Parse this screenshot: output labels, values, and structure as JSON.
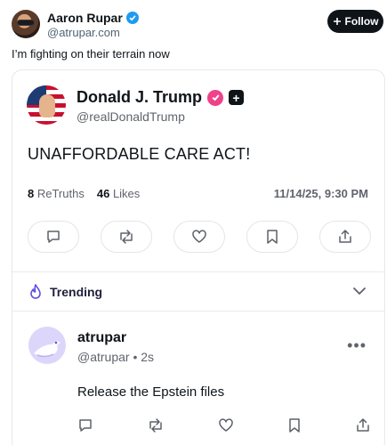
{
  "outer_post": {
    "author_name": "Aaron Rupar",
    "author_handle": "@atrupar.com",
    "follow_label": "Follow",
    "text": "I’m fighting on their terrain now",
    "verified_color": "#1d9bf0"
  },
  "embedded_truth": {
    "author_name": "Donald J. Trump",
    "author_handle": "@realDonaldTrump",
    "text": "UNAFFORDABLE CARE ACT!",
    "retruths_count": "8",
    "retruths_label": "ReTruths",
    "likes_count": "46",
    "likes_label": "Likes",
    "timestamp": "11/14/25, 9:30 PM",
    "badge_color": "#f0418b",
    "actions": [
      "comment-icon",
      "retruth-icon",
      "heart-icon",
      "bookmark-icon",
      "share-icon"
    ]
  },
  "trending": {
    "label": "Trending",
    "accent": "#5b4fe0"
  },
  "reply": {
    "author_name": "atrupar",
    "author_handle": "@atrupar",
    "separator": "•",
    "age": "2s",
    "more": "•••",
    "text": "Release the Epstein files"
  }
}
